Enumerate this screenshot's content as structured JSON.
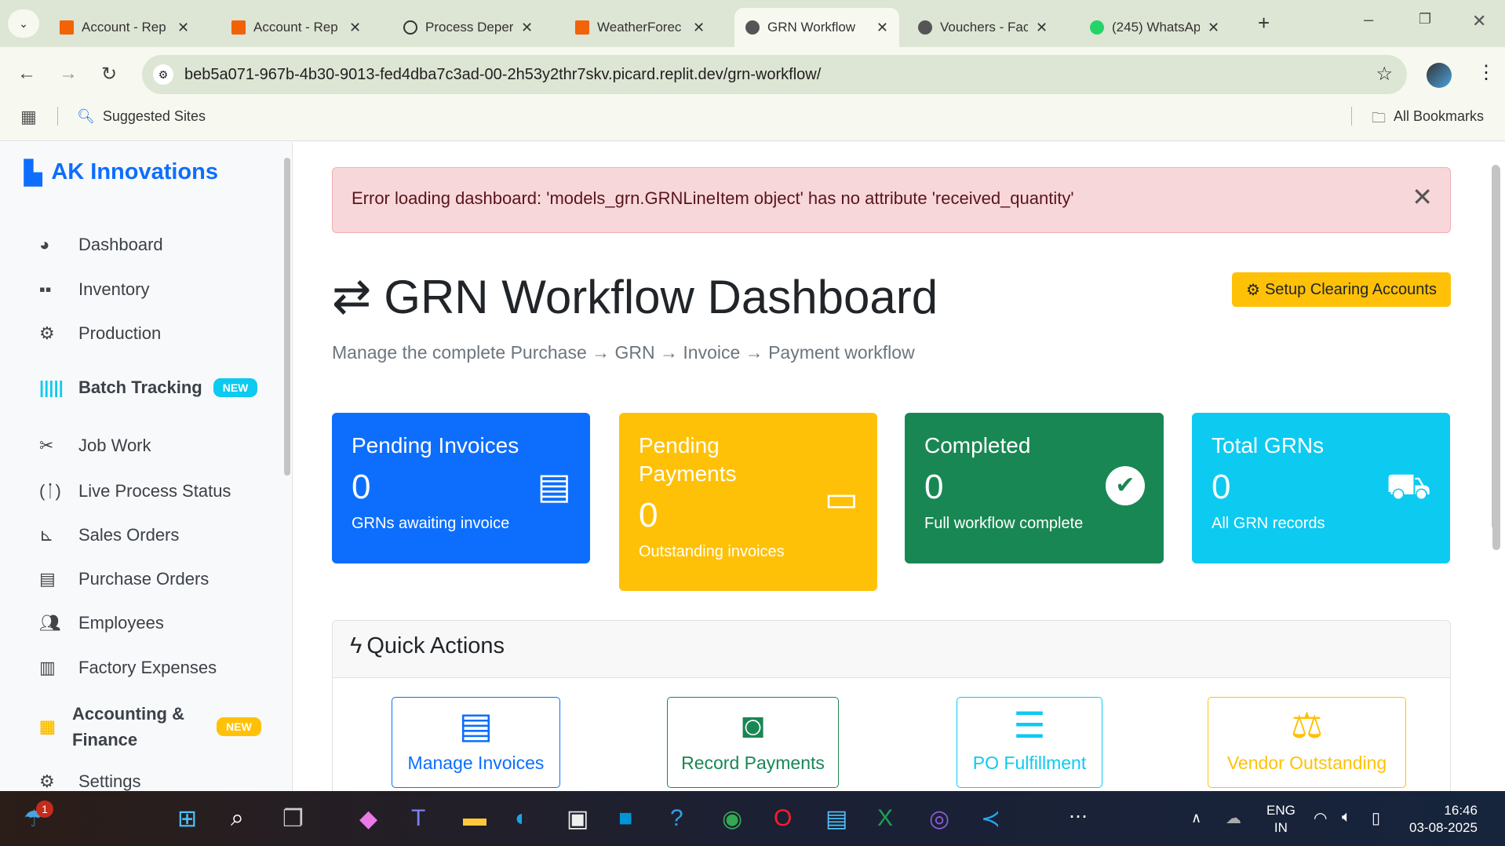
{
  "browser": {
    "tabs": [
      {
        "title": "Account - Rep",
        "active": false
      },
      {
        "title": "Account - Rep",
        "active": false
      },
      {
        "title": "Process Deper",
        "active": false
      },
      {
        "title": "WeatherForec",
        "active": false
      },
      {
        "title": "GRN Workflow",
        "active": true
      },
      {
        "title": "Vouchers - Fac",
        "active": false
      },
      {
        "title": "(245) WhatsAp",
        "active": false
      }
    ],
    "url": "beb5a071-967b-4b30-9013-fed4dba7c3ad-00-2h53y2thr7skv.picard.replit.dev/grn-workflow/",
    "bookmarks": {
      "suggested": "Suggested Sites",
      "all": "All Bookmarks"
    }
  },
  "sidebar": {
    "brand": "AK Innovations",
    "items": [
      {
        "label": "Dashboard",
        "icon": "gauge-icon"
      },
      {
        "label": "Inventory",
        "icon": "boxes-icon"
      },
      {
        "label": "Production",
        "icon": "cogs-icon"
      },
      {
        "label": "Batch Tracking",
        "icon": "barcode-icon",
        "badge": "NEW"
      },
      {
        "label": "Job Work",
        "icon": "tools-icon"
      },
      {
        "label": "Live Process Status",
        "icon": "broadcast-icon"
      },
      {
        "label": "Sales Orders",
        "icon": "chart-line-icon"
      },
      {
        "label": "Purchase Orders",
        "icon": "file-icon"
      },
      {
        "label": "Employees",
        "icon": "users-icon"
      },
      {
        "label": "Factory Expenses",
        "icon": "receipt-icon"
      },
      {
        "label": "Accounting &\nFinance",
        "icon": "calculator-icon",
        "badge": "NEW"
      },
      {
        "label": "Settings",
        "icon": "gear-icon"
      }
    ]
  },
  "alert": {
    "message": "Error loading dashboard: 'models_grn.GRNLineItem object' has no attribute 'received_quantity'"
  },
  "header": {
    "title": "GRN Workflow Dashboard",
    "subtitle": "Manage the complete Purchase → GRN → Invoice → Payment workflow",
    "setup_button": "Setup Clearing Accounts"
  },
  "cards": [
    {
      "title": "Pending Invoices",
      "value": "0",
      "sub": "GRNs awaiting invoice",
      "color": "#0d6efd"
    },
    {
      "title": "Pending Payments",
      "value": "0",
      "sub": "Outstanding invoices",
      "color": "#ffc107"
    },
    {
      "title": "Completed",
      "value": "0",
      "sub": "Full workflow complete",
      "color": "#198754"
    },
    {
      "title": "Total GRNs",
      "value": "0",
      "sub": "All GRN records",
      "color": "#0dcaf0"
    }
  ],
  "quick_actions": {
    "title": "Quick Actions",
    "items": [
      {
        "label": "Manage Invoices",
        "color": "#0d6efd"
      },
      {
        "label": "Record Payments",
        "color": "#198754"
      },
      {
        "label": "PO Fulfillment",
        "color": "#0dcaf0"
      },
      {
        "label": "Vendor Outstanding",
        "color": "#ffc107"
      }
    ]
  },
  "taskbar": {
    "lang1": "ENG",
    "lang2": "IN",
    "time": "16:46",
    "date": "03-08-2025",
    "notif": "1"
  }
}
